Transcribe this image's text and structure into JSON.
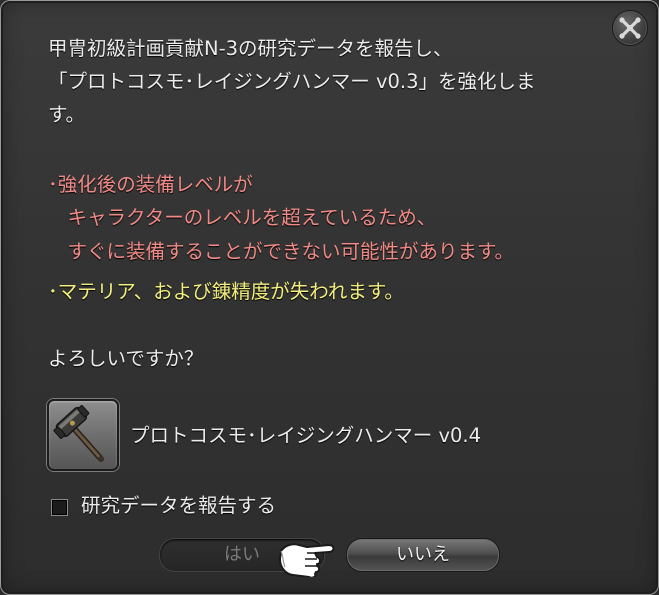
{
  "dialog": {
    "message_lines": [
      "甲冑初級計画貢献N-3の研究データを報告し、",
      "「プロトコスモ･レイジングハンマー v0.3」を強化しま",
      "す。"
    ],
    "warning_lines": [
      "･強化後の装備レベルが",
      "　キャラクターのレベルを超えているため、",
      "　すぐに装備することができない可能性があります。"
    ],
    "notice_line": "･マテリア、および錬精度が失われます。",
    "question": "よろしいですか？",
    "item": {
      "name": "プロトコスモ･レイジングハンマー v0.4",
      "icon": "hammer-icon"
    },
    "checkbox": {
      "label": "研究データを報告する",
      "checked": false
    },
    "buttons": {
      "yes": "はい",
      "no": "いいえ"
    },
    "close_icon": "close-icon",
    "pointer_icon": "pointing-hand-cursor"
  },
  "colors": {
    "text": "#ececec",
    "warning": "#f08a86",
    "notice": "#f2ef7e",
    "panel": "#353535"
  }
}
